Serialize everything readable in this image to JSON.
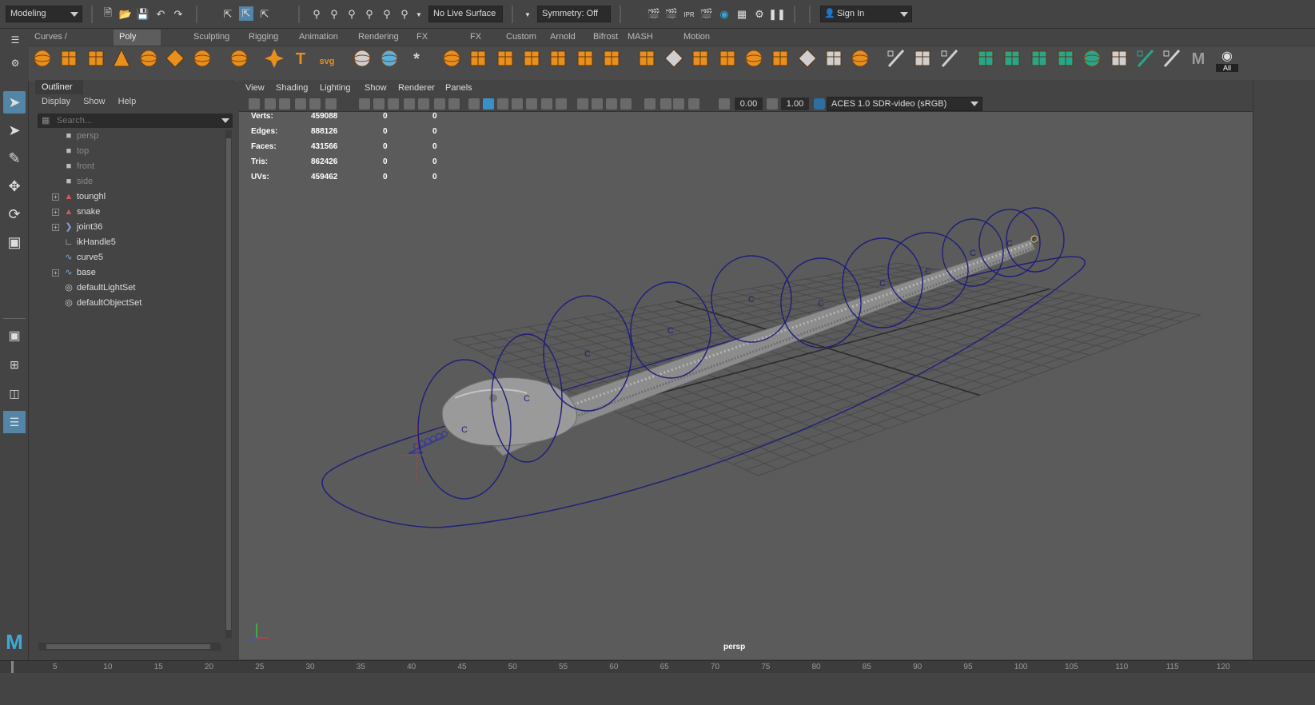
{
  "statusline": {
    "mode": "Modeling",
    "live_surface": "No Live Surface",
    "symmetry": "Symmetry: Off",
    "signin": "Sign In"
  },
  "shelf_tabs": [
    "Curves / Surfaces",
    "Poly Modeling",
    "Sculpting",
    "Rigging",
    "Animation",
    "Rendering",
    "FX",
    "FX Caching",
    "Custom",
    "Arnold",
    "Bifrost",
    "MASH",
    "Motion Graphics"
  ],
  "shelf_active": "Poly Modeling",
  "shelf_all_label": "All",
  "outliner": {
    "title": "Outliner",
    "menu": [
      "Display",
      "Show",
      "Help"
    ],
    "search_placeholder": "Search...",
    "items": [
      {
        "label": "persp",
        "icon": "camera-icon",
        "expandable": false,
        "dim": true
      },
      {
        "label": "top",
        "icon": "camera-icon",
        "expandable": false,
        "dim": true
      },
      {
        "label": "front",
        "icon": "camera-icon",
        "expandable": false,
        "dim": true
      },
      {
        "label": "side",
        "icon": "camera-icon",
        "expandable": false,
        "dim": true
      },
      {
        "label": "tounghl",
        "icon": "mesh-icon",
        "expandable": true,
        "dim": false
      },
      {
        "label": "snake",
        "icon": "mesh-icon",
        "expandable": true,
        "dim": false
      },
      {
        "label": "joint36",
        "icon": "joint-icon",
        "expandable": true,
        "dim": false
      },
      {
        "label": "ikHandle5",
        "icon": "ikhandle-icon",
        "expandable": false,
        "dim": false
      },
      {
        "label": "curve5",
        "icon": "curve-icon",
        "expandable": false,
        "dim": false
      },
      {
        "label": "base",
        "icon": "curve-icon",
        "expandable": true,
        "dim": false
      },
      {
        "label": "defaultLightSet",
        "icon": "set-icon",
        "expandable": false,
        "dim": false
      },
      {
        "label": "defaultObjectSet",
        "icon": "set-icon",
        "expandable": false,
        "dim": false
      }
    ]
  },
  "viewport": {
    "menu": [
      "View",
      "Shading",
      "Lighting",
      "Show",
      "Renderer",
      "Panels"
    ],
    "near_value": "0.00",
    "far_value": "1.00",
    "colorspace": "ACES 1.0 SDR-video (sRGB)",
    "camera_label": "persp",
    "hud": [
      {
        "label": "Verts:",
        "v1": "459088",
        "v2": "0",
        "v3": "0"
      },
      {
        "label": "Edges:",
        "v1": "888126",
        "v2": "0",
        "v3": "0"
      },
      {
        "label": "Faces:",
        "v1": "431566",
        "v2": "0",
        "v3": "0"
      },
      {
        "label": "Tris:",
        "v1": "862426",
        "v2": "0",
        "v3": "0"
      },
      {
        "label": "UVs:",
        "v1": "459462",
        "v2": "0",
        "v3": "0"
      }
    ],
    "ring_letter": "C"
  },
  "timeline": {
    "ticks": [
      "5",
      "10",
      "15",
      "20",
      "25",
      "30",
      "35",
      "40",
      "45",
      "50",
      "55",
      "60",
      "65",
      "70",
      "75",
      "80",
      "85",
      "90",
      "95",
      "100",
      "105",
      "110",
      "115",
      "120"
    ]
  },
  "colors": {
    "control_curve": "#1e1e7a",
    "accent_orange": "#e88f1e",
    "accent_teal": "#2aa58a",
    "active_tab": "#5d5d5d"
  }
}
